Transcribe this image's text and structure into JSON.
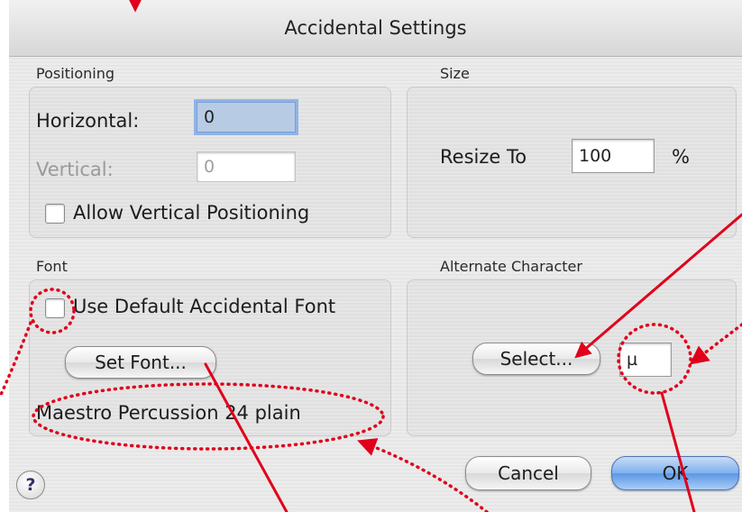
{
  "dialog": {
    "title": "Accidental Settings"
  },
  "positioning": {
    "label": "Positioning",
    "horizontal_label": "Horizontal:",
    "horizontal_value": "0",
    "vertical_label": "Vertical:",
    "vertical_value": "0",
    "allow_vertical_label": "Allow Vertical Positioning",
    "allow_vertical_checked": false
  },
  "size": {
    "label": "Size",
    "resize_label": "Resize To",
    "resize_value": "100",
    "unit": "%"
  },
  "font": {
    "label": "Font",
    "use_default_label": "Use Default Accidental Font",
    "use_default_checked": false,
    "set_font_button": "Set Font...",
    "current_font": "Maestro Percussion 24 plain"
  },
  "alternate": {
    "label": "Alternate Character",
    "select_button": "Select...",
    "character": "µ"
  },
  "footer": {
    "help_label": "?",
    "cancel_button": "Cancel",
    "ok_button": "OK"
  },
  "colors": {
    "annotation": "#e0001b",
    "default_button": "#6aa2e8",
    "focus_ring": "#8fb4e6"
  }
}
